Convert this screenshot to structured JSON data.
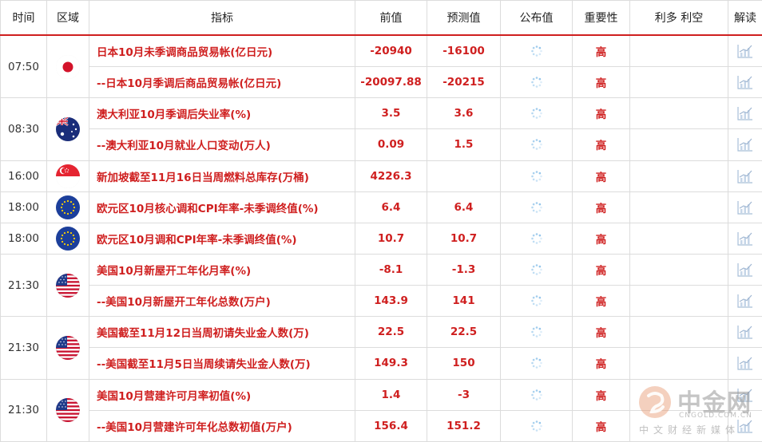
{
  "headers": {
    "time": "时间",
    "region": "区域",
    "indicator": "指标",
    "previous": "前值",
    "forecast": "预测值",
    "actual": "公布值",
    "importance": "重要性",
    "effect": "利多 利空",
    "analysis": "解读"
  },
  "colors": {
    "accent_red": "#cf1f1f",
    "grid": "#dcdcdc"
  },
  "groups": [
    {
      "time": "07:50",
      "flag": "japan-flag",
      "rows": [
        {
          "indicator": "日本10月未季调商品贸易帐(亿日元)",
          "previous": "-20940",
          "forecast": "-16100",
          "importance": "高"
        },
        {
          "indicator": "--日本10月季调后商品贸易帐(亿日元)",
          "previous": "-20097.88",
          "forecast": "-20215",
          "importance": "高"
        }
      ]
    },
    {
      "time": "08:30",
      "flag": "australia-flag",
      "rows": [
        {
          "indicator": "澳大利亚10月季调后失业率(%)",
          "previous": "3.5",
          "forecast": "3.6",
          "importance": "高"
        },
        {
          "indicator": "--澳大利亚10月就业人口变动(万人)",
          "previous": "0.09",
          "forecast": "1.5",
          "importance": "高"
        }
      ]
    },
    {
      "time": "16:00",
      "flag": "singapore-flag",
      "rows": [
        {
          "indicator": "新加坡截至11月16日当周燃料总库存(万桶)",
          "previous": "4226.3",
          "forecast": "",
          "importance": "高"
        }
      ]
    },
    {
      "time": "18:00",
      "flag": "eu-flag",
      "rows": [
        {
          "indicator": "欧元区10月核心调和CPI年率-未季调终值(%)",
          "previous": "6.4",
          "forecast": "6.4",
          "importance": "高"
        }
      ]
    },
    {
      "time": "18:00",
      "flag": "eu-flag",
      "rows": [
        {
          "indicator": "欧元区10月调和CPI年率-未季调终值(%)",
          "previous": "10.7",
          "forecast": "10.7",
          "importance": "高"
        }
      ]
    },
    {
      "time": "21:30",
      "flag": "usa-flag",
      "rows": [
        {
          "indicator": "美国10月新屋开工年化月率(%)",
          "previous": "-8.1",
          "forecast": "-1.3",
          "importance": "高"
        },
        {
          "indicator": "--美国10月新屋开工年化总数(万户)",
          "previous": "143.9",
          "forecast": "141",
          "importance": "高"
        }
      ]
    },
    {
      "time": "21:30",
      "flag": "usa-flag",
      "rows": [
        {
          "indicator": "美国截至11月12日当周初请失业金人数(万)",
          "previous": "22.5",
          "forecast": "22.5",
          "importance": "高"
        },
        {
          "indicator": "--美国截至11月5日当周续请失业金人数(万)",
          "previous": "149.3",
          "forecast": "150",
          "importance": "高"
        }
      ]
    },
    {
      "time": "21:30",
      "flag": "usa-flag",
      "rows": [
        {
          "indicator": "美国10月营建许可月率初值(%)",
          "previous": "1.4",
          "forecast": "-3",
          "importance": "高"
        },
        {
          "indicator": "--美国10月营建许可年化总数初值(万户)",
          "previous": "156.4",
          "forecast": "151.2",
          "importance": "高"
        }
      ]
    }
  ],
  "watermark": {
    "name": "中金网",
    "url": "CNGOLD.COM.CN",
    "slogan": "中文财经新媒体"
  }
}
